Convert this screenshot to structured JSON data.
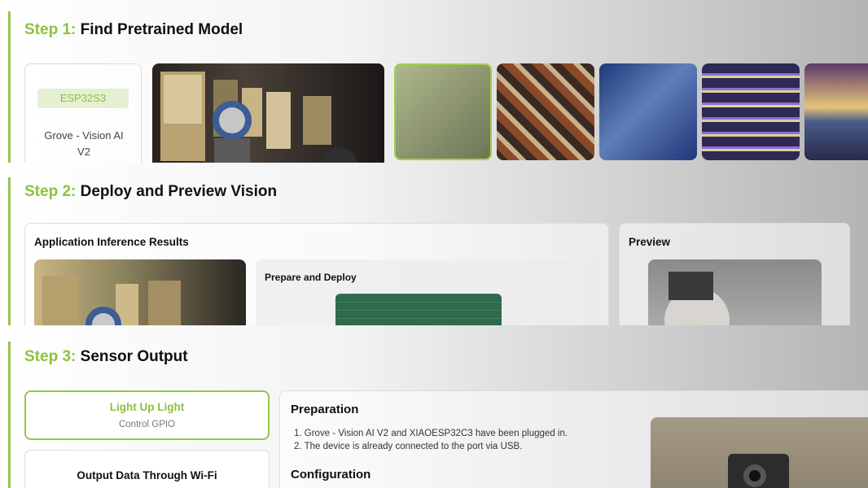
{
  "step1": {
    "prefix": "Step 1:",
    "title": "Find Pretrained Model",
    "device_chip": "ESP32S3",
    "device_name_1": "Grove - Vision AI",
    "device_name_2": "V2",
    "thumbnails": [
      "robot-gallery",
      "cube-pattern",
      "blue-wave",
      "stacked-layers",
      "sunset-grid"
    ]
  },
  "step2": {
    "prefix": "Step 2:",
    "title": "Deploy and Preview Vision",
    "results_title": "Application Inference Results",
    "prepare_title": "Prepare and Deploy",
    "preview_title": "Preview"
  },
  "step3": {
    "prefix": "Step 3:",
    "title": "Sensor Output",
    "option1_title": "Light Up Light",
    "option1_sub": "Control GPIO",
    "option2_title": "Output Data Through Wi-Fi",
    "prep_heading": "Preparation",
    "prep_steps": [
      "1. Grove - Vision AI V2 and XIAOESP32C3 have been plugged in.",
      "2. The device is already connected to the port via USB."
    ],
    "config_heading": "Configuration"
  },
  "colors": {
    "accent": "#8dc13f"
  }
}
